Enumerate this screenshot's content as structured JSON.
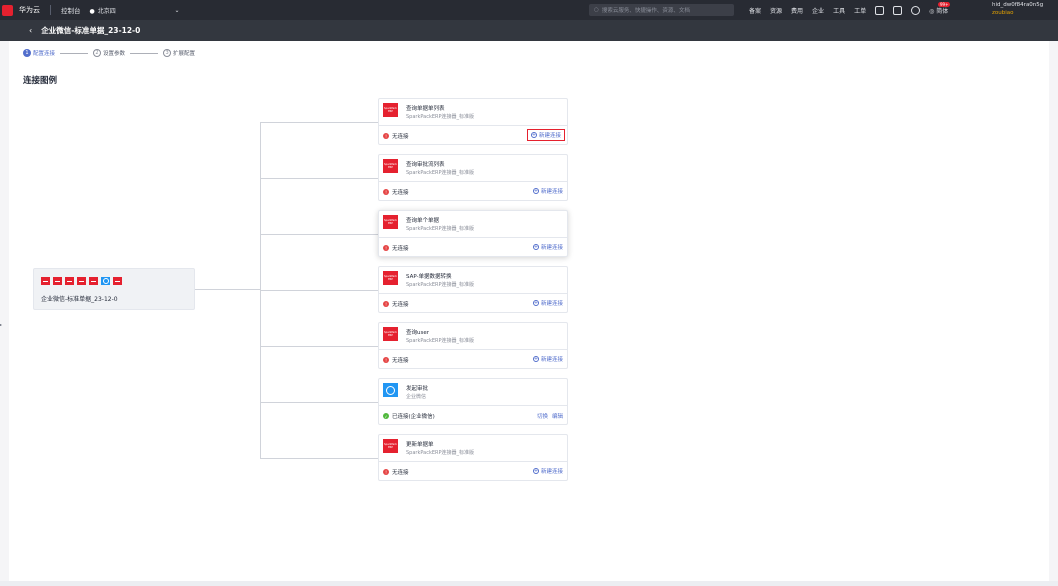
{
  "topbar": {
    "logo_label": "HUAWEI",
    "brand": "华为云",
    "console": "控制台",
    "region": "北京四",
    "search_placeholder": "搜索云服务、快捷操作、资源、文档",
    "nav": [
      "备案",
      "资源",
      "费用",
      "企业",
      "工具",
      "工单"
    ],
    "badge": "99+",
    "language": "简体",
    "user_line1": "hid_dw0f84ra0n5g",
    "user_line2": "zoubiao"
  },
  "subheader": {
    "title": "企业微信-标准单据_23-12-0"
  },
  "steps": [
    {
      "num": "1",
      "label": "配置连接"
    },
    {
      "num": "2",
      "label": "设置参数"
    },
    {
      "num": "3",
      "label": "扩展配置"
    }
  ],
  "section_title": "连接图例",
  "source": {
    "name": "企业微信-标准单据_23-12-0"
  },
  "cards": [
    {
      "title": "查询单据单列表",
      "sub": "SparkPackERP连接器_标准版",
      "status": "无连接",
      "action": "新建连接"
    },
    {
      "title": "查询审批流列表",
      "sub": "SparkPackERP连接器_标准版",
      "status": "无连接",
      "action": "新建连接"
    },
    {
      "title": "查询单个单据",
      "sub": "SparkPackERP连接器_标准版",
      "status": "无连接",
      "action": "新建连接"
    },
    {
      "title": "SAP-单据数据转换",
      "sub": "SparkPackERP连接器_标准版",
      "status": "无连接",
      "action": "新建连接"
    },
    {
      "title": "查询user",
      "sub": "SparkPackERP连接器_标准版",
      "status": "无连接",
      "action": "新建连接"
    },
    {
      "title": "发起审批",
      "sub": "企业微信",
      "status": "已连接(企业微信)",
      "action_switch": "切换",
      "action_edit": "编辑"
    },
    {
      "title": "更新单据单",
      "sub": "SparkPackERP连接器_标准版",
      "status": "无连接",
      "action": "新建连接"
    }
  ],
  "card_icon_label": "SparkPack ERP",
  "colors": {
    "accent": "#526ecc",
    "brand_red": "#e5212f",
    "error": "#e54545",
    "ok": "#50b83c"
  }
}
